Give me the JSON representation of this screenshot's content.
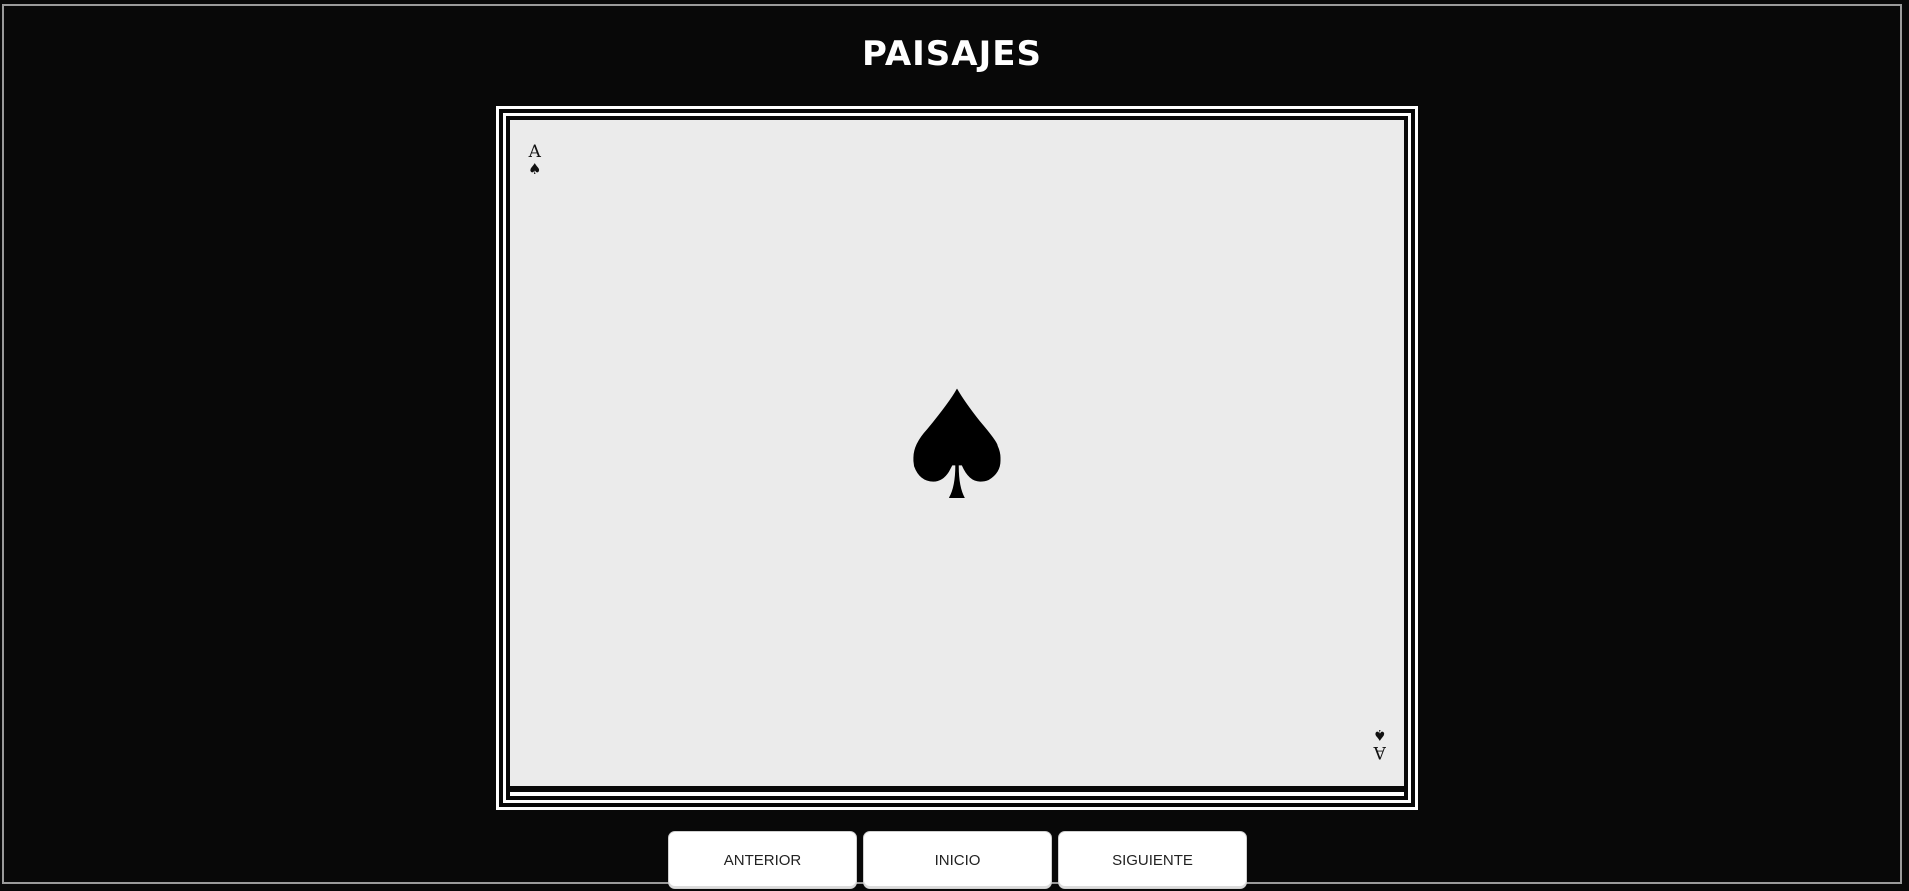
{
  "page": {
    "title": "PAISAJES"
  },
  "card": {
    "rank": "A",
    "suit_symbol": "♠",
    "suit_icon": "spade-icon",
    "face_color": "#ebebeb"
  },
  "navigation": {
    "previous_label": "ANTERIOR",
    "home_label": "INICIO",
    "next_label": "SIGUIENTE"
  },
  "colors": {
    "background": "#080808",
    "frame": "#ffffff",
    "button": "#ffffff"
  }
}
